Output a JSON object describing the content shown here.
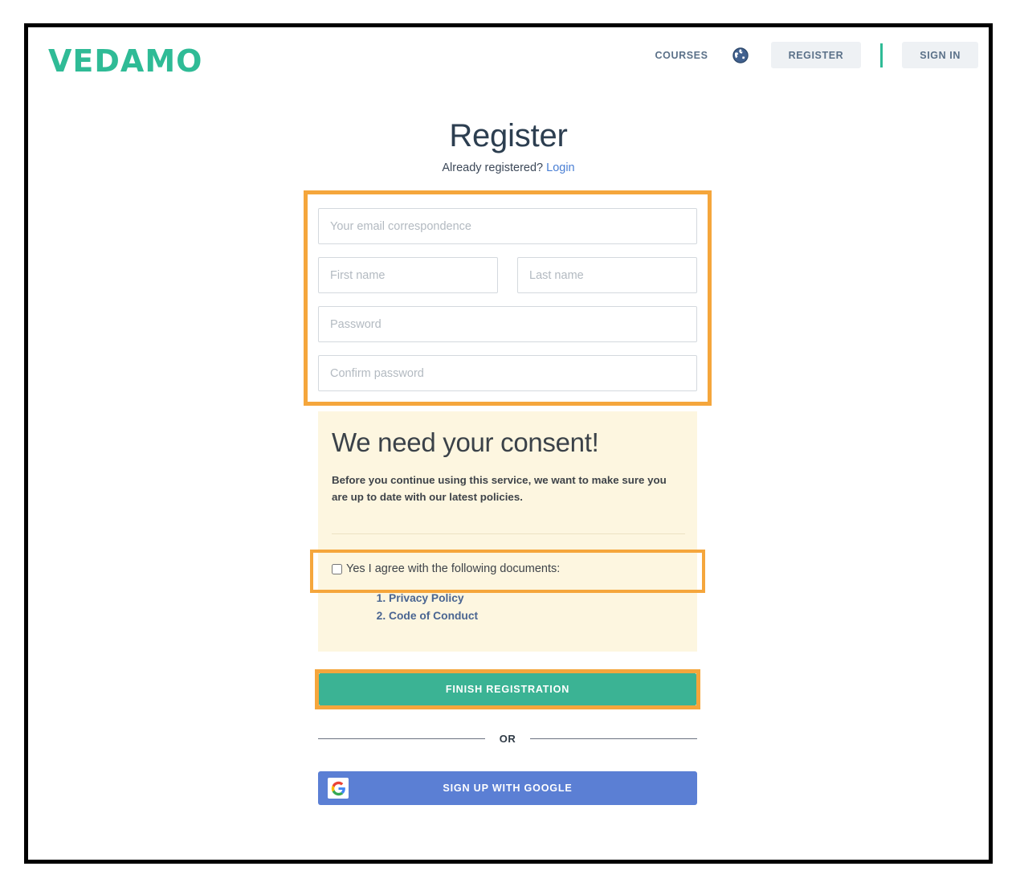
{
  "header": {
    "logo_text": "VEDAMO",
    "nav_courses": "COURSES",
    "globe_icon": "globe-icon",
    "register_button": "REGISTER",
    "signin_button": "SIGN IN"
  },
  "main": {
    "title": "Register",
    "already_text": "Already registered?",
    "login_link": "Login"
  },
  "form": {
    "email_placeholder": "Your email correspondence",
    "email_value": "",
    "first_name_placeholder": "First name",
    "first_name_value": "",
    "last_name_placeholder": "Last name",
    "last_name_value": "",
    "password_placeholder": "Password",
    "password_value": "",
    "confirm_password_placeholder": "Confirm password",
    "confirm_password_value": ""
  },
  "consent": {
    "heading": "We need your consent!",
    "description": "Before you continue using this service, we want to make sure you are up to date with our latest policies.",
    "agree_label": "Yes I agree with the following documents:",
    "agree_checked": false,
    "documents": [
      "Privacy Policy",
      "Code of Conduct"
    ]
  },
  "actions": {
    "finish_button": "FINISH REGISTRATION",
    "or_text": "OR",
    "google_button": "SIGN UP WITH GOOGLE",
    "google_icon": "google-g-icon"
  },
  "colors": {
    "brand_teal": "#2fbb96",
    "button_teal": "#3bb394",
    "highlight_orange": "#f5a63c",
    "consent_bg": "#fdf6e0",
    "google_blue": "#5b7fd4",
    "link_blue": "#4a7fd4",
    "doc_link_blue": "#4a6591",
    "title_navy": "#2c3e50",
    "nav_slate": "#5b7189"
  }
}
